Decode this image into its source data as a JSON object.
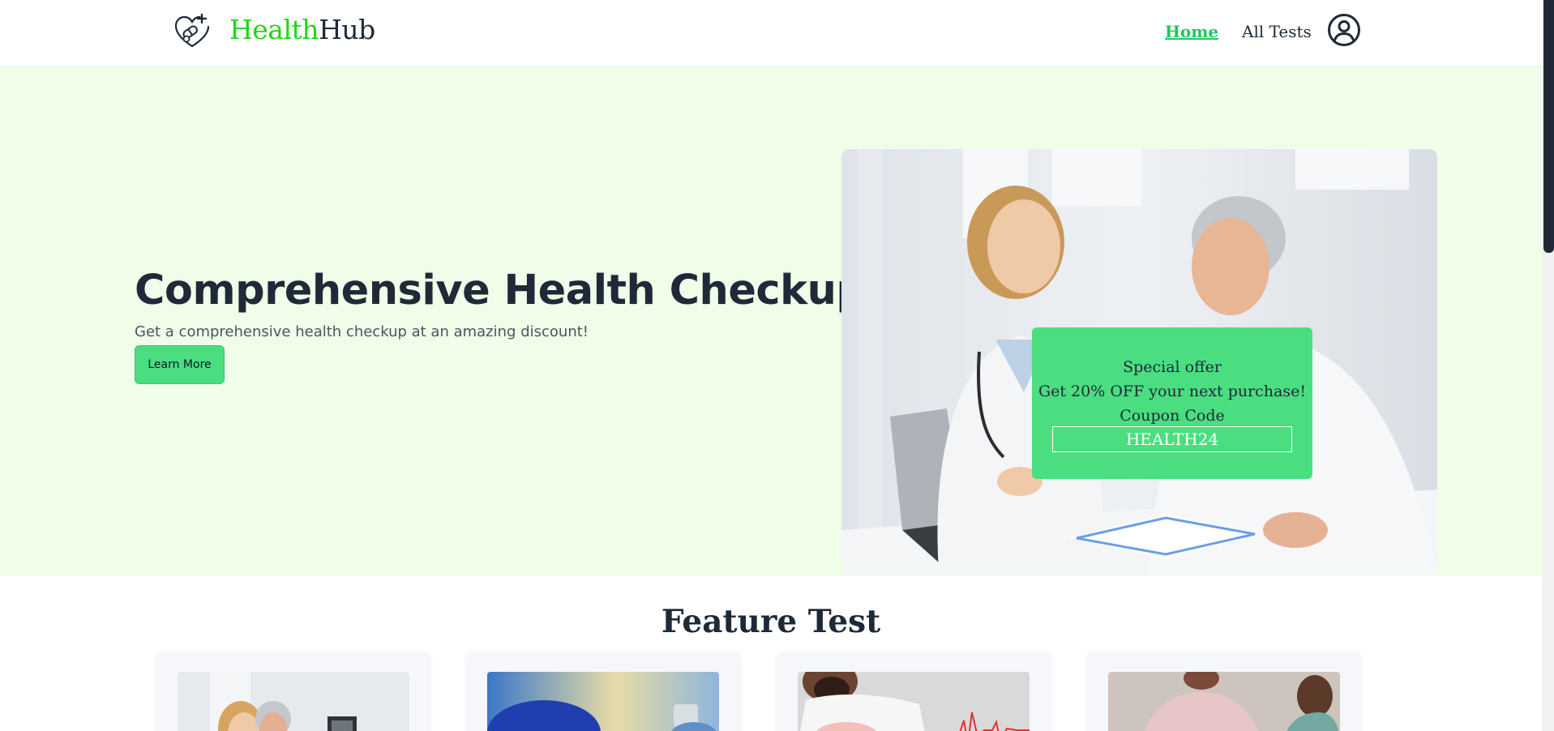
{
  "header": {
    "brand_part1": "Health",
    "brand_part2": "Hub",
    "nav": {
      "home": "Home",
      "all_tests": "All Tests"
    },
    "logo_icon": "heart-pills-icon",
    "profile_icon": "user-circle-icon"
  },
  "hero": {
    "title": "Comprehensive Health Checkup",
    "subtitle": "Get a comprehensive health checkup at an amazing discount!",
    "button_label": "Learn More",
    "offer": {
      "heading": "Special offer",
      "line": "Get 20% OFF your next purchase!",
      "coupon_label": "Coupon Code",
      "coupon_code": "HEALTH24"
    }
  },
  "features": {
    "title": "Feature Test",
    "cards": [
      {
        "image": "doctor-xray-photo"
      },
      {
        "image": "blood-pressure-photo"
      },
      {
        "image": "heart-ecg-photo"
      },
      {
        "image": "patient-consultation-photo"
      }
    ]
  },
  "colors": {
    "brand_green": "#22d616",
    "accent_green": "#4ade80",
    "hero_bg": "#f0fde8",
    "text_dark": "#1f2937"
  }
}
